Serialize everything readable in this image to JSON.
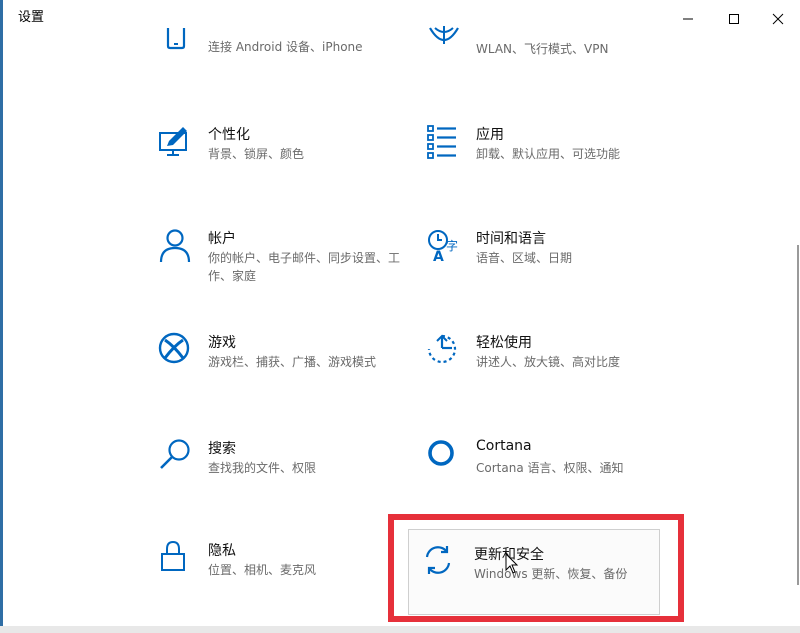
{
  "window": {
    "title": "设置"
  },
  "tiles": {
    "phone": {
      "desc": "连接 Android 设备、iPhone",
      "icon": "phone-icon"
    },
    "network": {
      "desc": "WLAN、飞行模式、VPN",
      "icon": "globe-icon"
    },
    "personalization": {
      "name": "个性化",
      "desc": "背景、锁屏、颜色",
      "icon": "personalization-icon"
    },
    "apps": {
      "name": "应用",
      "desc": "卸载、默认应用、可选功能",
      "icon": "apps-list-icon"
    },
    "accounts": {
      "name": "帐户",
      "desc": "你的帐户、电子邮件、同步设置、工作、家庭",
      "icon": "person-icon"
    },
    "time_language": {
      "name": "时间和语言",
      "desc": "语音、区域、日期",
      "icon": "time-language-icon"
    },
    "gaming": {
      "name": "游戏",
      "desc": "游戏栏、捕获、广播、游戏模式",
      "icon": "xbox-icon"
    },
    "ease_of_access": {
      "name": "轻松使用",
      "desc": "讲述人、放大镜、高对比度",
      "icon": "ease-of-access-icon"
    },
    "search": {
      "name": "搜索",
      "desc": "查找我的文件、权限",
      "icon": "search-icon"
    },
    "cortana": {
      "name": "Cortana",
      "desc": "Cortana 语言、权限、通知",
      "icon": "cortana-icon"
    },
    "privacy": {
      "name": "隐私",
      "desc": "位置、相机、麦克风",
      "icon": "lock-icon"
    },
    "update_security": {
      "name": "更新和安全",
      "desc": "Windows 更新、恢复、备份",
      "icon": "sync-icon"
    }
  },
  "colors": {
    "accent": "#0067c0",
    "highlight_border": "#e6303a",
    "title_text": "#000000"
  }
}
